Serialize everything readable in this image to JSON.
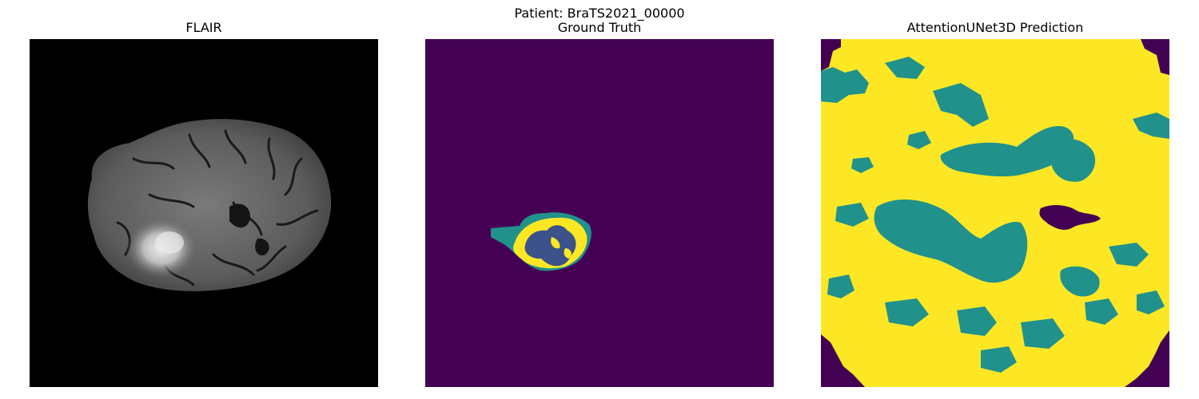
{
  "figure": {
    "suptitle": "Patient: BraTS2021_00000",
    "panels": [
      {
        "title": "FLAIR"
      },
      {
        "title": "Ground Truth"
      },
      {
        "title": "AttentionUNet3D Prediction"
      }
    ]
  },
  "colors": {
    "background_black": "#000000",
    "viridis_0": "#440154",
    "viridis_1": "#3b528b",
    "viridis_2": "#21918c",
    "viridis_3": "#fde725"
  }
}
